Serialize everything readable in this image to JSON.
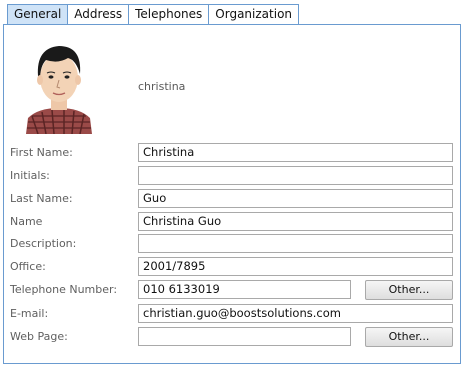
{
  "tabs": [
    "General",
    "Address",
    "Telephones",
    "Organization"
  ],
  "username": "christina",
  "fields": {
    "first_name": {
      "label": "First Name:",
      "value": "Christina"
    },
    "initials": {
      "label": "Initials:",
      "value": ""
    },
    "last_name": {
      "label": "Last Name:",
      "value": "Guo"
    },
    "name": {
      "label": "Name",
      "value": "Christina Guo"
    },
    "description": {
      "label": "Description:",
      "value": ""
    },
    "office": {
      "label": "Office:",
      "value": "2001/7895"
    },
    "telephone": {
      "label": "Telephone Number:",
      "value": "010 6133019"
    },
    "email": {
      "label": "E-mail:",
      "value": "christian.guo@boostsolutions.com"
    },
    "web_page": {
      "label": "Web Page:",
      "value": ""
    }
  },
  "buttons": {
    "telephone_other": "Other...",
    "web_other": "Other..."
  },
  "colors": {
    "tab_border": "#6a9bd0",
    "active_tab": "#cfe3f7"
  }
}
